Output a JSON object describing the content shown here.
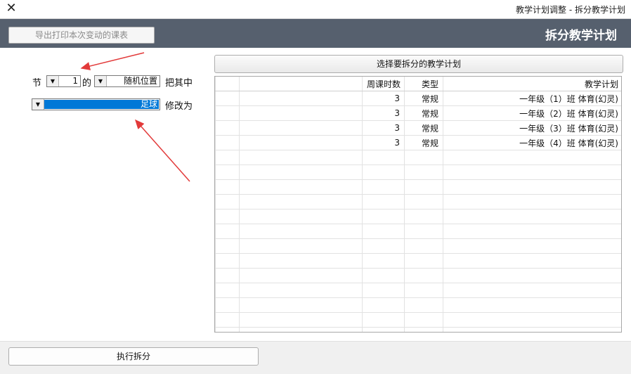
{
  "window": {
    "title": "教学计划调整 - 拆分教学计划",
    "close_glyph": "✕"
  },
  "header": {
    "title": "拆分教学计划"
  },
  "left_panel": {
    "export_button": "导出打印本次变动的课表",
    "row1": {
      "prefix": "把其中",
      "combo_position": "随机位置",
      "middle": "的",
      "combo_count": "1",
      "suffix": "节"
    },
    "row2": {
      "prefix": "修改为",
      "combo_value": "足球"
    }
  },
  "right_panel": {
    "select_button": "选择要拆分的教学计划",
    "table": {
      "columns": [
        "教学计划",
        "类型",
        "周课时数"
      ],
      "rows": [
        {
          "plan": "一年级（1）班 体育(幻灵)",
          "type": "常规",
          "hours": "3"
        },
        {
          "plan": "一年级（2）班 体育(幻灵)",
          "type": "常规",
          "hours": "3"
        },
        {
          "plan": "一年级（3）班 体育(幻灵)",
          "type": "常规",
          "hours": "3"
        },
        {
          "plan": "一年级（4）班 体育(幻灵)",
          "type": "常规",
          "hours": "3"
        }
      ]
    }
  },
  "footer": {
    "execute_button": "执行拆分"
  },
  "colors": {
    "header_bg": "#56606e",
    "selection": "#0078d7",
    "arrow": "#e23a3a"
  }
}
